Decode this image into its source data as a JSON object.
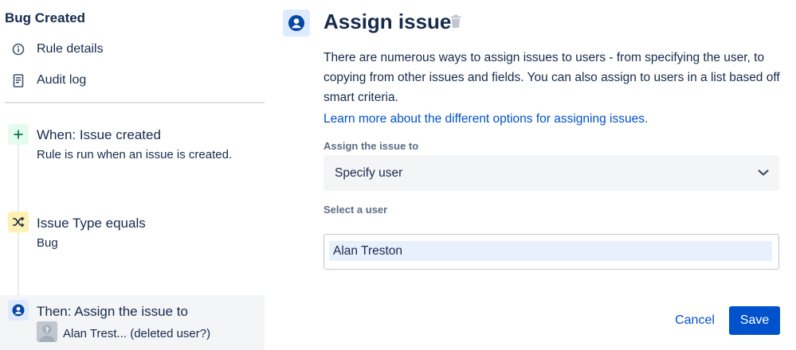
{
  "sidebar": {
    "rule_title": "Bug Created",
    "menu": [
      {
        "label": "Rule details",
        "icon": "info-icon"
      },
      {
        "label": "Audit log",
        "icon": "document-icon"
      }
    ],
    "components": [
      {
        "title": "When: Issue created",
        "subtitle": "Rule is run when an issue is created.",
        "icon": "plus-icon",
        "color": "#e3fcef"
      },
      {
        "title": "Issue Type equals",
        "subtitle": "Bug",
        "icon": "shuffle-icon",
        "color": "#fff0b3"
      },
      {
        "title": "Then: Assign the issue to",
        "subtitle": "Alan Trest... (deleted user?)",
        "icon": "user-circle-icon",
        "color": "#deebff"
      }
    ]
  },
  "main": {
    "title": "Assign issue",
    "description": "There are numerous ways to assign issues to users - from specifying the user, to copying from other issues and fields. You can also assign to users in a list based off smart criteria.",
    "learn_more": "Learn more about the different options for assigning issues.",
    "assign_label": "Assign the issue to",
    "assign_value": "Specify user",
    "select_user_label": "Select a user",
    "selected_user": "Alan Treston",
    "cancel": "Cancel",
    "save": "Save"
  },
  "colors": {
    "accent": "#0052cc",
    "text": "#172b4d",
    "muted": "#5e6c84"
  }
}
